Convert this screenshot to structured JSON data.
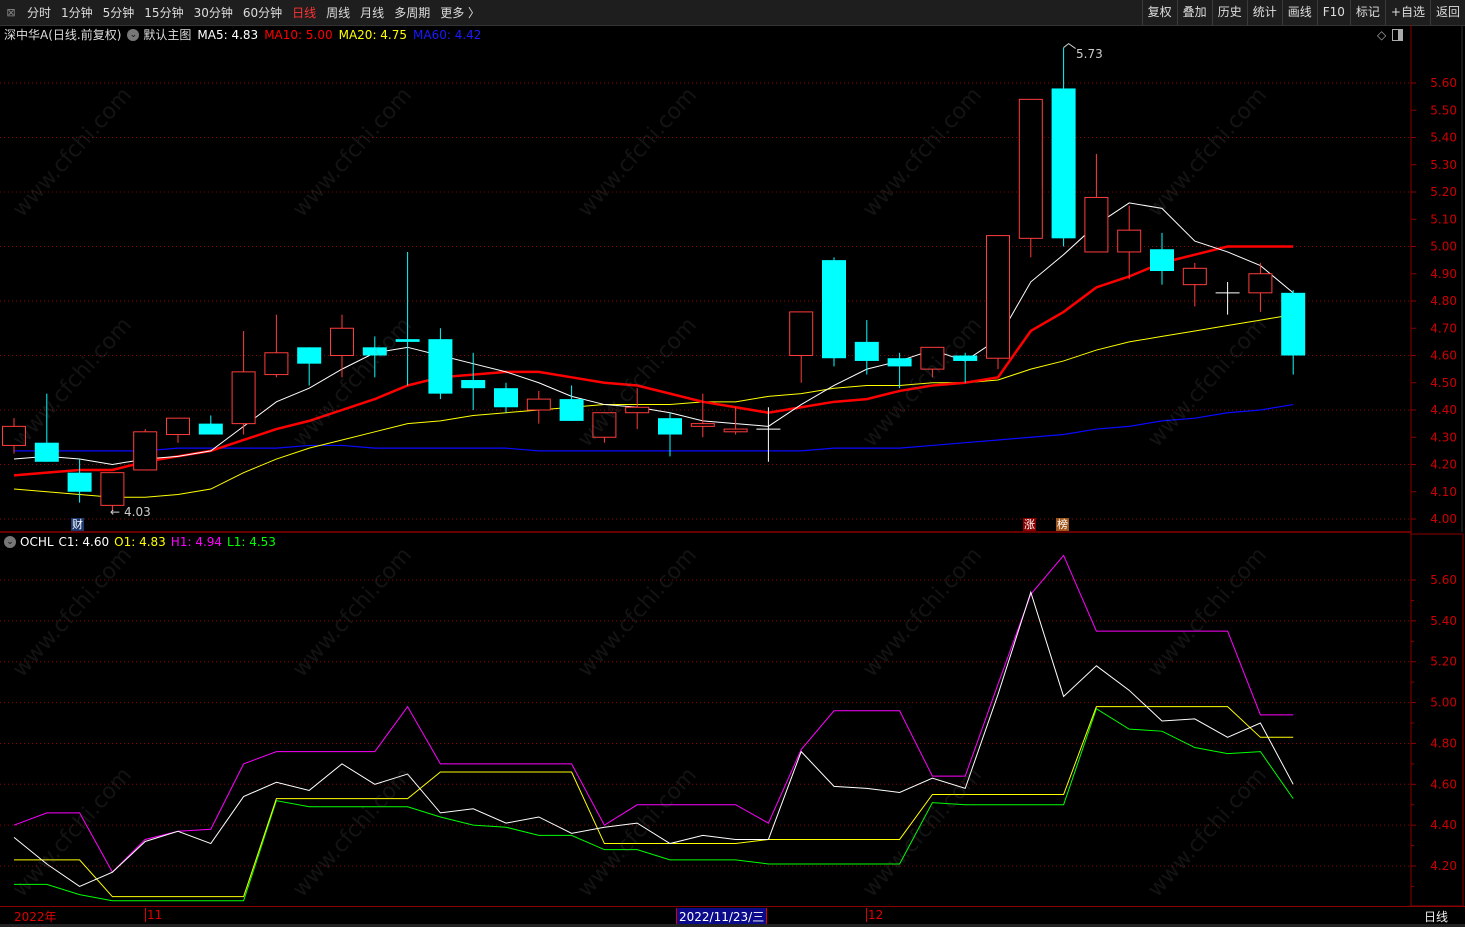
{
  "toolbar": {
    "periods": [
      "分时",
      "1分钟",
      "5分钟",
      "15分钟",
      "30分钟",
      "60分钟",
      "日线",
      "周线",
      "月线",
      "多周期",
      "更多 〉"
    ],
    "active_period": "日线",
    "buttons": [
      "复权",
      "叠加",
      "历史",
      "统计",
      "画线",
      "F10",
      "标记",
      "+自选",
      "返回"
    ]
  },
  "info": {
    "stock": "深中华A(日线.前复权)",
    "template": "默认主图",
    "ma5": "MA5: 4.83",
    "ma10": "MA10: 5.00",
    "ma20": "MA20: 4.75",
    "ma60": "MA60: 4.42"
  },
  "indicator": {
    "name": "OCHL",
    "c1": "C1: 4.60",
    "o1": "O1: 4.83",
    "h1": "H1: 4.94",
    "l1": "L1: 4.53"
  },
  "colors": {
    "up": "#ff3c3c",
    "down": "#00ffff",
    "ma5": "#ffffff",
    "ma10": "#ff0000",
    "ma20": "#ffff00",
    "ma60": "#0a0aff",
    "c1": "#ffffff",
    "o1": "#ffff00",
    "h1": "#ff00ff",
    "l1": "#00ff00",
    "axis": "#cc0000"
  },
  "annotations": {
    "low_label": "4.03",
    "high_label": "5.73"
  },
  "markers": {
    "cai": "财",
    "zhang": "涨",
    "bang": "榜"
  },
  "date_axis": {
    "year": "2022年",
    "nov": "11",
    "cursor": "2022/11/23/三",
    "dec": "12",
    "period": "日线"
  },
  "watermark": "www.cfchi.com",
  "chart_data": [
    {
      "type": "candlestick",
      "title": "深中华A(日线.前复权)",
      "ylim": [
        4.0,
        5.6
      ],
      "y_ticks": [
        "5.60",
        "5.50",
        "5.40",
        "5.30",
        "5.20",
        "5.10",
        "5.00",
        "4.90",
        "4.80",
        "4.70",
        "4.60",
        "4.50",
        "4.40",
        "4.30",
        "4.20",
        "4.10",
        "4.00"
      ],
      "ohlc": [
        [
          4.27,
          4.37,
          4.24,
          4.34
        ],
        [
          4.28,
          4.46,
          4.21,
          4.21
        ],
        [
          4.17,
          4.22,
          4.06,
          4.1
        ],
        [
          4.05,
          4.17,
          4.03,
          4.17
        ],
        [
          4.18,
          4.33,
          4.18,
          4.32
        ],
        [
          4.31,
          4.37,
          4.28,
          4.37
        ],
        [
          4.35,
          4.38,
          4.31,
          4.31
        ],
        [
          4.35,
          4.69,
          4.31,
          4.54
        ],
        [
          4.53,
          4.75,
          4.52,
          4.61
        ],
        [
          4.63,
          4.63,
          4.49,
          4.57
        ],
        [
          4.6,
          4.75,
          4.52,
          4.7
        ],
        [
          4.63,
          4.67,
          4.52,
          4.6
        ],
        [
          4.66,
          4.98,
          4.49,
          4.65
        ],
        [
          4.66,
          4.7,
          4.44,
          4.46
        ],
        [
          4.51,
          4.61,
          4.4,
          4.48
        ],
        [
          4.48,
          4.5,
          4.39,
          4.41
        ],
        [
          4.4,
          4.47,
          4.35,
          4.44
        ],
        [
          4.44,
          4.49,
          4.36,
          4.36
        ],
        [
          4.3,
          4.39,
          4.28,
          4.39
        ],
        [
          4.39,
          4.48,
          4.33,
          4.41
        ],
        [
          4.37,
          4.39,
          4.23,
          4.31
        ],
        [
          4.34,
          4.46,
          4.3,
          4.35
        ],
        [
          4.32,
          4.41,
          4.31,
          4.33
        ],
        [
          4.33,
          4.41,
          4.21,
          4.33
        ],
        [
          4.6,
          4.76,
          4.5,
          4.76
        ],
        [
          4.95,
          4.96,
          4.56,
          4.59
        ],
        [
          4.65,
          4.73,
          4.53,
          4.58
        ],
        [
          4.59,
          4.61,
          4.48,
          4.56
        ],
        [
          4.55,
          4.63,
          4.52,
          4.63
        ],
        [
          4.6,
          4.61,
          4.5,
          4.58
        ],
        [
          4.59,
          5.04,
          4.55,
          5.04
        ],
        [
          5.03,
          5.54,
          4.96,
          5.54
        ],
        [
          5.58,
          5.73,
          5.0,
          5.03
        ],
        [
          4.98,
          5.34,
          4.98,
          5.18
        ],
        [
          4.98,
          5.15,
          4.88,
          5.06
        ],
        [
          4.99,
          5.05,
          4.86,
          4.91
        ],
        [
          4.86,
          4.94,
          4.78,
          4.92
        ],
        [
          4.83,
          4.87,
          4.75,
          4.83
        ],
        [
          4.83,
          4.94,
          4.76,
          4.9
        ],
        [
          4.83,
          4.84,
          4.53,
          4.6
        ]
      ],
      "series": [
        {
          "name": "MA5",
          "values": [
            4.22,
            4.23,
            4.22,
            4.2,
            4.22,
            4.23,
            4.25,
            4.34,
            4.43,
            4.48,
            4.55,
            4.61,
            4.63,
            4.6,
            4.57,
            4.54,
            4.5,
            4.45,
            4.42,
            4.41,
            4.39,
            4.36,
            4.35,
            4.34,
            4.42,
            4.49,
            4.55,
            4.58,
            4.62,
            4.58,
            4.66,
            4.87,
            4.97,
            5.08,
            5.16,
            5.14,
            5.02,
            4.98,
            4.93,
            4.83
          ]
        },
        {
          "name": "MA10",
          "values": [
            4.16,
            4.17,
            4.18,
            4.18,
            4.21,
            4.23,
            4.25,
            4.29,
            4.33,
            4.36,
            4.4,
            4.44,
            4.49,
            4.52,
            4.53,
            4.54,
            4.54,
            4.52,
            4.5,
            4.49,
            4.46,
            4.43,
            4.41,
            4.39,
            4.41,
            4.43,
            4.44,
            4.47,
            4.49,
            4.5,
            4.52,
            4.69,
            4.76,
            4.85,
            4.89,
            4.94,
            4.97,
            5.0,
            5.0,
            5.0
          ]
        },
        {
          "name": "MA20",
          "values": [
            4.11,
            4.1,
            4.09,
            4.08,
            4.08,
            4.09,
            4.11,
            4.17,
            4.22,
            4.26,
            4.29,
            4.32,
            4.35,
            4.36,
            4.38,
            4.39,
            4.4,
            4.41,
            4.42,
            4.42,
            4.42,
            4.43,
            4.43,
            4.45,
            4.46,
            4.48,
            4.49,
            4.49,
            4.5,
            4.5,
            4.51,
            4.55,
            4.58,
            4.62,
            4.65,
            4.67,
            4.69,
            4.71,
            4.73,
            4.75
          ]
        },
        {
          "name": "MA60",
          "values": [
            4.25,
            4.25,
            4.25,
            4.25,
            4.25,
            4.26,
            4.26,
            4.26,
            4.26,
            4.27,
            4.27,
            4.26,
            4.26,
            4.26,
            4.26,
            4.26,
            4.25,
            4.25,
            4.25,
            4.25,
            4.25,
            4.25,
            4.25,
            4.25,
            4.25,
            4.26,
            4.26,
            4.26,
            4.27,
            4.28,
            4.29,
            4.3,
            4.31,
            4.33,
            4.34,
            4.36,
            4.37,
            4.39,
            4.4,
            4.42
          ]
        }
      ]
    },
    {
      "type": "line",
      "title": "OCHL",
      "ylim": [
        4.1,
        5.8
      ],
      "y_ticks": [
        "5.60",
        "5.40",
        "5.20",
        "5.00",
        "4.80",
        "4.60",
        "4.40",
        "4.20"
      ],
      "series": [
        {
          "name": "C1",
          "values": [
            4.34,
            4.21,
            4.1,
            4.17,
            4.32,
            4.37,
            4.31,
            4.54,
            4.61,
            4.57,
            4.7,
            4.6,
            4.65,
            4.46,
            4.48,
            4.41,
            4.44,
            4.36,
            4.39,
            4.41,
            4.31,
            4.35,
            4.33,
            4.33,
            4.76,
            4.59,
            4.58,
            4.56,
            4.63,
            4.58,
            5.04,
            5.54,
            5.03,
            5.18,
            5.06,
            4.91,
            4.92,
            4.83,
            4.9,
            4.6
          ]
        },
        {
          "name": "O1",
          "values": [
            4.23,
            4.23,
            4.23,
            4.05,
            4.05,
            4.05,
            4.05,
            4.05,
            4.53,
            4.53,
            4.53,
            4.53,
            4.53,
            4.66,
            4.66,
            4.66,
            4.66,
            4.66,
            4.31,
            4.31,
            4.31,
            4.31,
            4.31,
            4.33,
            4.33,
            4.33,
            4.33,
            4.33,
            4.55,
            4.55,
            4.55,
            4.55,
            4.55,
            4.98,
            4.98,
            4.98,
            4.98,
            4.98,
            4.83,
            4.83
          ]
        },
        {
          "name": "H1",
          "values": [
            4.4,
            4.46,
            4.46,
            4.17,
            4.33,
            4.37,
            4.38,
            4.7,
            4.76,
            4.76,
            4.76,
            4.76,
            4.98,
            4.7,
            4.7,
            4.7,
            4.7,
            4.7,
            4.4,
            4.5,
            4.5,
            4.5,
            4.5,
            4.41,
            4.77,
            4.96,
            4.96,
            4.96,
            4.64,
            4.64,
            5.09,
            5.53,
            5.72,
            5.35,
            5.35,
            5.35,
            5.35,
            5.35,
            4.94,
            4.94
          ]
        },
        {
          "name": "L1",
          "values": [
            4.11,
            4.11,
            4.06,
            4.03,
            4.03,
            4.03,
            4.03,
            4.03,
            4.52,
            4.49,
            4.49,
            4.49,
            4.49,
            4.44,
            4.4,
            4.39,
            4.35,
            4.35,
            4.28,
            4.28,
            4.23,
            4.23,
            4.23,
            4.21,
            4.21,
            4.21,
            4.21,
            4.21,
            4.51,
            4.5,
            4.5,
            4.5,
            4.5,
            4.97,
            4.87,
            4.86,
            4.78,
            4.75,
            4.76,
            4.53
          ]
        }
      ]
    }
  ]
}
